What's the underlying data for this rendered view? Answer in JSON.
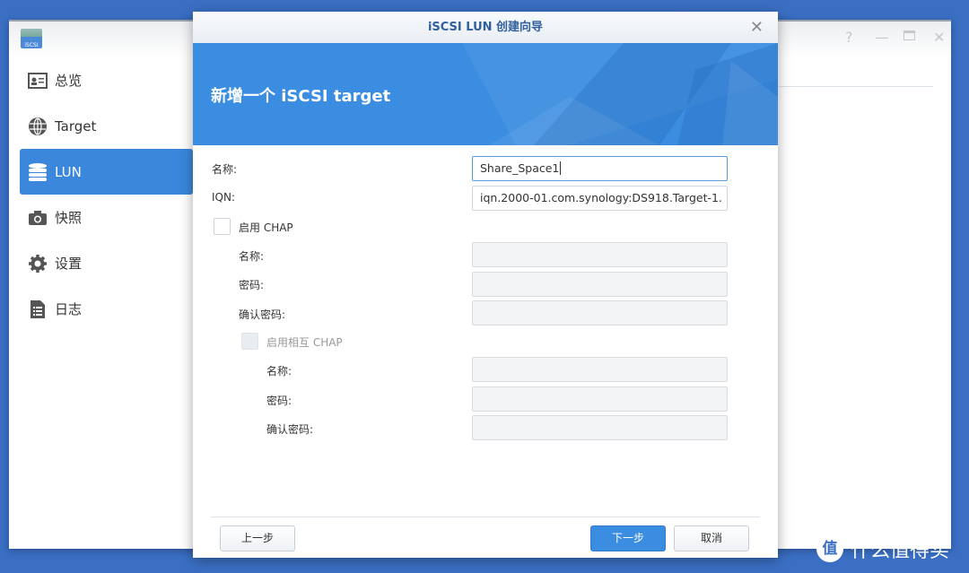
{
  "app": {
    "icon_label": "iSCSI",
    "controls": [
      "help-icon",
      "minimize-icon",
      "maximize-icon",
      "close-icon"
    ]
  },
  "sidebar": {
    "items": [
      {
        "label": "总览",
        "icon": "overview-icon",
        "active": false
      },
      {
        "label": "Target",
        "icon": "globe-icon",
        "active": false
      },
      {
        "label": "LUN",
        "icon": "database-icon",
        "active": true
      },
      {
        "label": "快照",
        "icon": "camera-icon",
        "active": false
      },
      {
        "label": "设置",
        "icon": "gear-icon",
        "active": false
      },
      {
        "label": "日志",
        "icon": "log-icon",
        "active": false
      }
    ]
  },
  "dialog": {
    "title": "iSCSI LUN 创建向导",
    "banner_title": "新增一个 iSCSI target",
    "fields": {
      "name_label": "名称:",
      "name_value": "Share_Space1",
      "iqn_label": "IQN:",
      "iqn_value": "iqn.2000-01.com.synology:DS918.Target-1.",
      "chap_label": "启用 CHAP",
      "chap_checked": false,
      "chap_name_label": "名称:",
      "chap_pwd_label": "密码:",
      "chap_confirm_label": "确认密码:",
      "mutual_label": "启用相互 CHAP",
      "mutual_checked": false,
      "mutual_name_label": "名称:",
      "mutual_pwd_label": "密码:",
      "mutual_confirm_label": "确认密码:"
    },
    "buttons": {
      "prev": "上一步",
      "next": "下一步",
      "cancel": "取消"
    }
  },
  "colors": {
    "accent": "#3a8de0",
    "desktop": "#3a6fc4"
  },
  "watermark": {
    "logo": "值",
    "text": "什么值得买"
  }
}
